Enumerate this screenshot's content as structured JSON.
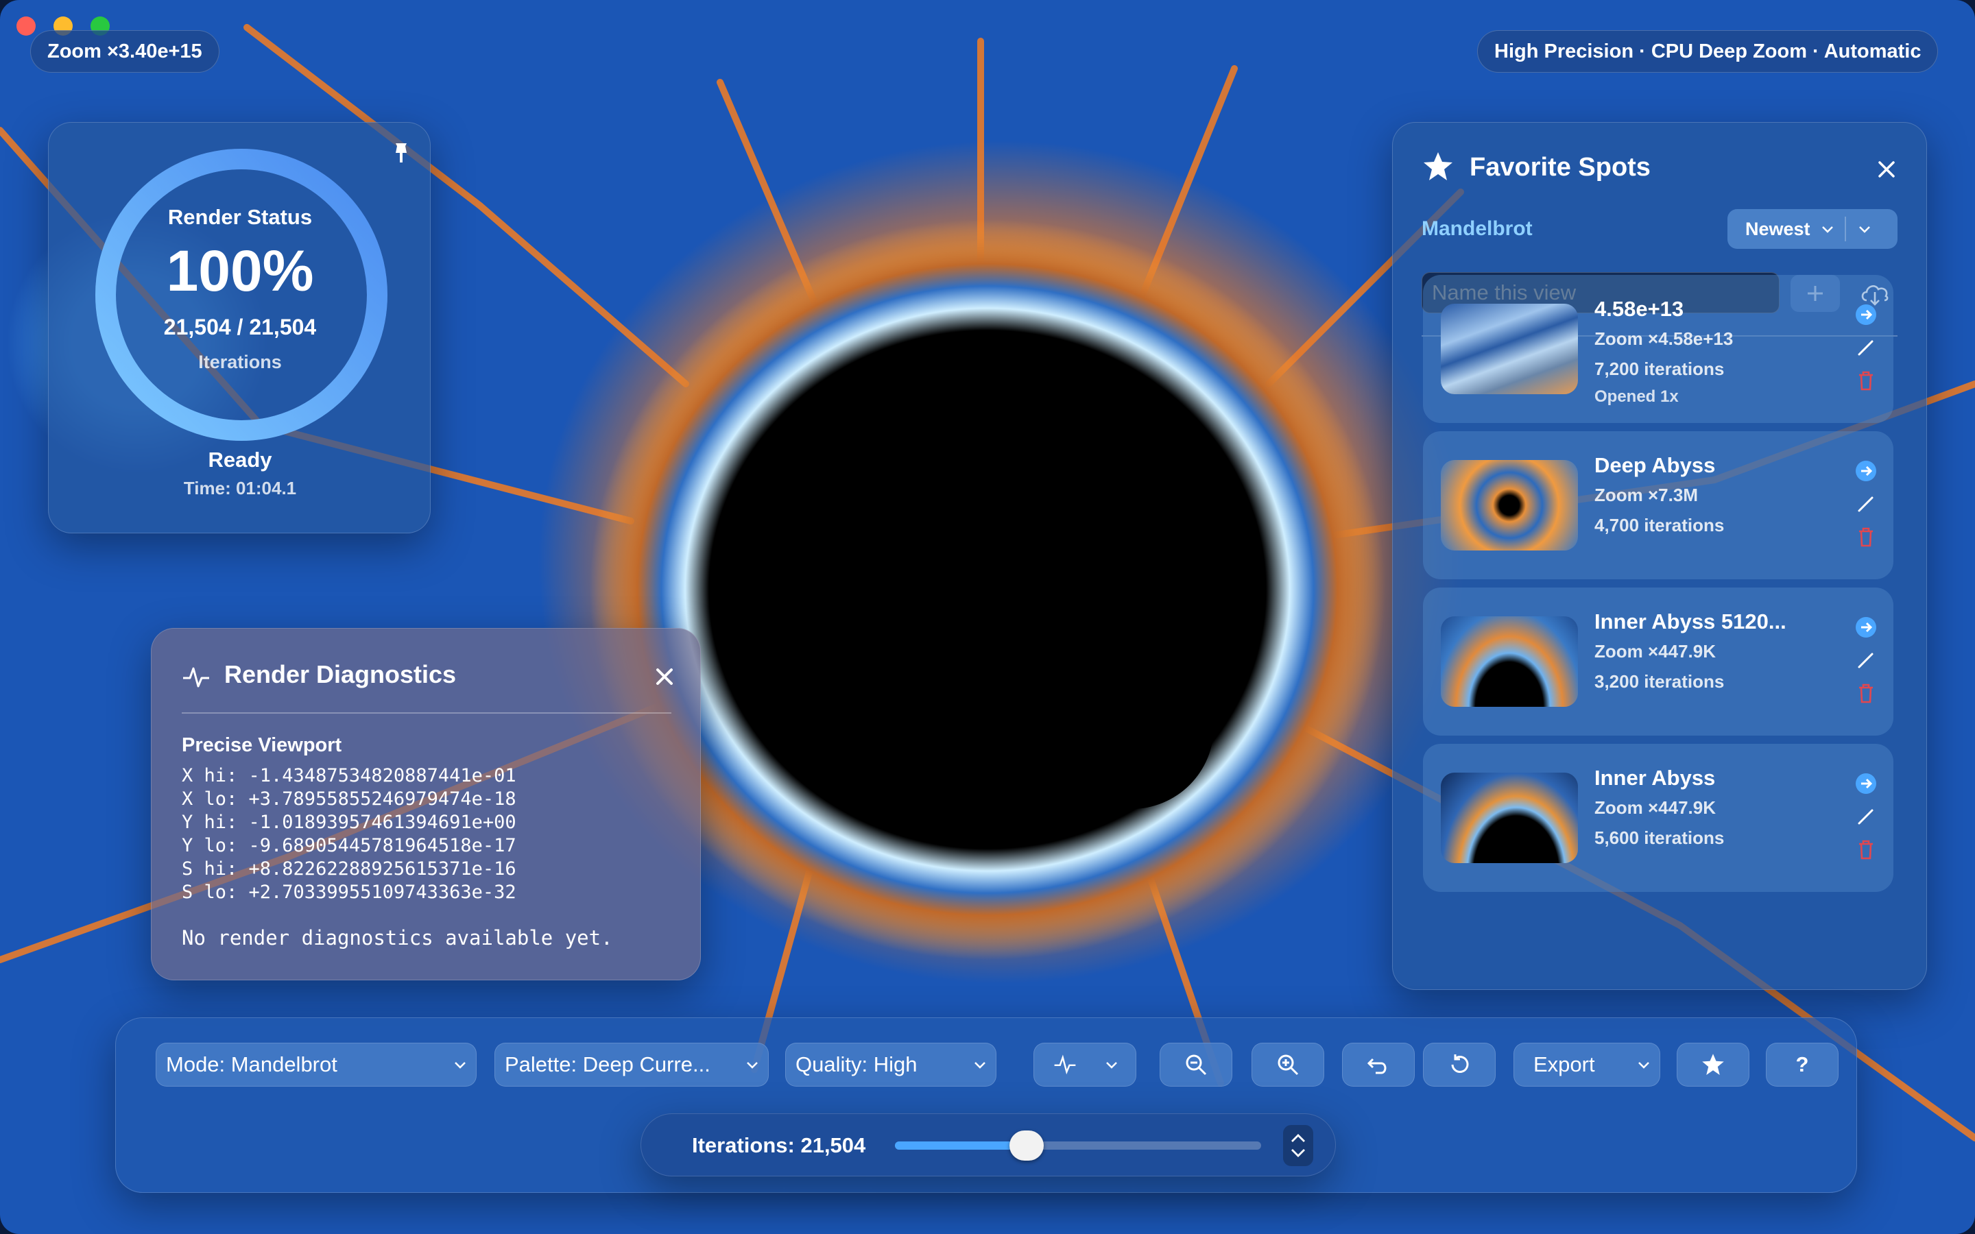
{
  "window": {
    "zoom_readout": "Zoom ×3.40e+15",
    "render_mode_readout": "High Precision · CPU Deep Zoom · Automatic"
  },
  "colors": {
    "close": "#ff5f57",
    "minimize": "#febc2e",
    "maximize": "#28c840",
    "accent": "#4aa6ff",
    "delete": "#e2474f"
  },
  "render_status": {
    "title": "Render Status",
    "percent": "100%",
    "progress_fraction": 1.0,
    "iterations_text": "21,504 / 21,504",
    "iterations_label": "Iterations",
    "state": "Ready",
    "time": "Time: 01:04.1"
  },
  "diagnostics": {
    "title": "Render Diagnostics",
    "section_title": "Precise Viewport",
    "lines": [
      "X hi: -1.43487534820887441e-01",
      "X lo: +3.78955855246979474e-18",
      "Y hi: -1.01893957461394691e+00",
      "Y lo: -9.68905445781964518e-17",
      "S hi: +8.82262288925615371e-16",
      "S lo: +2.70339955109743363e-32"
    ],
    "empty_message": "No render diagnostics available yet."
  },
  "favorites": {
    "title": "Favorite Spots",
    "fractal_filter": "Mandelbrot",
    "sort": "Newest",
    "name_placeholder": "Name this view",
    "items": [
      {
        "name": "4.58e+13",
        "zoom": "Zoom ×4.58e+13",
        "iterations": "7,200 iterations",
        "opened": "Opened 1x"
      },
      {
        "name": "Deep Abyss",
        "zoom": "Zoom ×7.3M",
        "iterations": "4,700 iterations",
        "opened": ""
      },
      {
        "name": "Inner Abyss 5120...",
        "zoom": "Zoom ×447.9K",
        "iterations": "3,200 iterations",
        "opened": ""
      },
      {
        "name": "Inner Abyss",
        "zoom": "Zoom ×447.9K",
        "iterations": "5,600 iterations",
        "opened": ""
      }
    ]
  },
  "toolbar": {
    "mode": "Mode: Mandelbrot",
    "palette": "Palette: Deep Curre...",
    "quality": "Quality: High",
    "export": "Export",
    "help": "?"
  },
  "iterations_control": {
    "label": "Iterations: 21,504",
    "slider_fraction": 0.36
  }
}
